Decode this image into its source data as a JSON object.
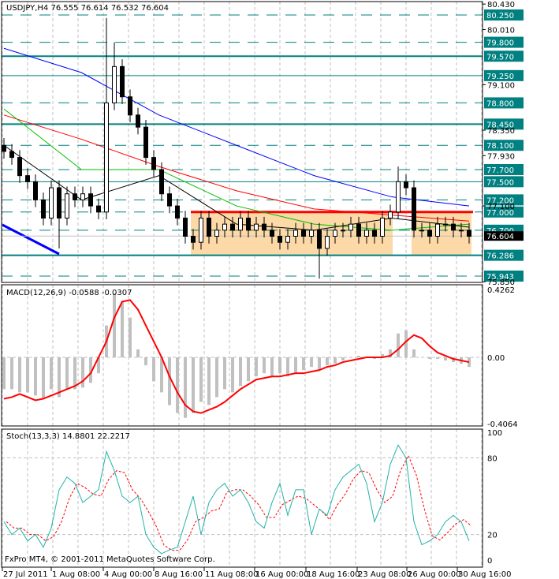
{
  "colors": {
    "level": "#008080",
    "label_bg": "#008080",
    "ma_blue": "#0000ff",
    "ma_red": "#ff0000",
    "ma_green": "#00c000",
    "ma_black": "#000000",
    "zone": "#fcd9a6",
    "macd_hist": "#c0c0c0",
    "macd_signal": "#ff0000",
    "stoch_main": "#20b2aa",
    "stoch_signal": "#ff0000"
  },
  "chart_data": [
    {
      "type": "candlestick",
      "title": "USDJPY,H4",
      "quote": {
        "open": "76.555",
        "high": "76.614",
        "low": "76.532",
        "close": "76.604"
      },
      "current_price": "76.604",
      "ylim": [
        75.85,
        80.43
      ],
      "plain_ticks": [
        "80.430",
        "80.010",
        "79.100",
        "78.350",
        "77.930",
        "77.100",
        "75.850"
      ],
      "levels": [
        {
          "price": 80.25,
          "label": "80.250",
          "style": "dashed"
        },
        {
          "price": 79.8,
          "label": "79.800",
          "style": "dashed"
        },
        {
          "price": 79.57,
          "label": "79.570",
          "style": "thick"
        },
        {
          "price": 79.25,
          "label": "79.250",
          "style": "solid"
        },
        {
          "price": 78.8,
          "label": "78.800",
          "style": "dashed"
        },
        {
          "price": 78.45,
          "label": "78.450",
          "style": "thick"
        },
        {
          "price": 78.1,
          "label": "78.100",
          "style": "dashed"
        },
        {
          "price": 77.7,
          "label": "77.700",
          "style": "dashed"
        },
        {
          "price": 77.5,
          "label": "77.500",
          "style": "solid"
        },
        {
          "price": 77.2,
          "label": "77.200",
          "style": "dashed"
        },
        {
          "price": 77.0,
          "label": "77.000",
          "style": "dashed"
        },
        {
          "price": 76.7,
          "label": "76.700",
          "style": "dashed"
        },
        {
          "price": 76.286,
          "label": "76.286",
          "style": "thick"
        },
        {
          "price": 75.943,
          "label": "75.943",
          "style": "dashed"
        }
      ],
      "closes": [
        78.0,
        77.9,
        77.6,
        77.5,
        77.2,
        76.9,
        77.4,
        76.9,
        77.3,
        77.2,
        77.3,
        77.1,
        77.0,
        78.8,
        79.4,
        78.9,
        78.6,
        78.4,
        77.9,
        77.7,
        77.3,
        77.1,
        76.9,
        76.6,
        76.5,
        76.9,
        76.6,
        76.7,
        76.8,
        76.7,
        76.9,
        76.7,
        76.8,
        76.7,
        76.6,
        76.5,
        76.6,
        76.7,
        76.6,
        76.7,
        76.4,
        76.6,
        76.7,
        76.7,
        76.8,
        76.6,
        76.7,
        76.6,
        76.9,
        77.0,
        77.5,
        77.4,
        76.7,
        76.7,
        76.6,
        76.8,
        76.8,
        76.7,
        76.7,
        76.6
      ],
      "spikes": [
        {
          "i": 13,
          "high": 80.2
        },
        {
          "i": 14,
          "high": 79.8
        },
        {
          "i": 40,
          "low": 75.9
        },
        {
          "i": 50,
          "high": 77.75
        },
        {
          "i": 7,
          "low": 76.4
        }
      ],
      "moving_averages": [
        {
          "name": "blue",
          "values": [
            79.7,
            79.3,
            78.6,
            78.1,
            77.6,
            77.25,
            77.1
          ]
        },
        {
          "name": "red",
          "values": [
            78.6,
            78.2,
            77.75,
            77.35,
            77.05,
            76.95,
            76.85
          ]
        },
        {
          "name": "green",
          "values": [
            78.7,
            77.7,
            77.7,
            77.1,
            76.8,
            76.7,
            76.8
          ]
        },
        {
          "name": "black",
          "values": [
            78.1,
            77.2,
            77.6,
            76.8,
            76.7,
            76.9,
            76.75
          ]
        }
      ],
      "zones": [
        {
          "from": [
            24,
            49
          ],
          "top": 77.0,
          "bottom": 76.286
        },
        {
          "from": [
            52,
            59
          ],
          "top": 77.0,
          "bottom": 76.286
        }
      ],
      "trendline": {
        "from": [
          78.0,
          76.286
        ]
      }
    },
    {
      "type": "macd",
      "label": "MACD(12,26,9) -0.0588 -0.0307",
      "ylim": [
        -0.4064,
        0.4262
      ],
      "ticks": [
        "0.4262",
        "0.00",
        "-0.4064"
      ],
      "histogram": [
        -0.2,
        -0.2,
        -0.22,
        -0.22,
        -0.24,
        -0.26,
        -0.2,
        -0.25,
        -0.2,
        -0.2,
        -0.19,
        -0.16,
        -0.1,
        0.2,
        0.4,
        0.35,
        0.25,
        0.05,
        -0.05,
        -0.15,
        -0.22,
        -0.3,
        -0.35,
        -0.38,
        -0.35,
        -0.28,
        -0.3,
        -0.25,
        -0.2,
        -0.22,
        -0.18,
        -0.15,
        -0.12,
        -0.1,
        -0.12,
        -0.1,
        -0.12,
        -0.1,
        -0.08,
        -0.06,
        -0.08,
        -0.05,
        -0.04,
        -0.02,
        0.0,
        0.01,
        0.0,
        -0.01,
        0.02,
        0.05,
        0.15,
        0.17,
        0.05,
        0.0,
        -0.01,
        -0.01,
        -0.02,
        -0.03,
        -0.04,
        -0.06
      ],
      "signal": [
        -0.26,
        -0.25,
        -0.23,
        -0.25,
        -0.27,
        -0.26,
        -0.24,
        -0.22,
        -0.2,
        -0.18,
        -0.15,
        -0.1,
        0.0,
        0.1,
        0.25,
        0.35,
        0.36,
        0.3,
        0.2,
        0.1,
        -0.0,
        -0.12,
        -0.22,
        -0.3,
        -0.34,
        -0.35,
        -0.33,
        -0.31,
        -0.28,
        -0.24,
        -0.2,
        -0.17,
        -0.14,
        -0.13,
        -0.12,
        -0.12,
        -0.11,
        -0.1,
        -0.1,
        -0.09,
        -0.08,
        -0.06,
        -0.05,
        -0.03,
        -0.02,
        -0.01,
        0.0,
        0.0,
        0.0,
        0.01,
        0.05,
        0.1,
        0.14,
        0.12,
        0.07,
        0.03,
        0.01,
        -0.01,
        -0.02,
        -0.03
      ]
    },
    {
      "type": "stochastic",
      "label": "Stoch(13,3,3) 14.8801 22.2217",
      "ylim": [
        0,
        100
      ],
      "ticks": [
        "100",
        "80",
        "20",
        "0"
      ],
      "main": [
        30,
        20,
        25,
        15,
        20,
        10,
        25,
        55,
        65,
        60,
        45,
        50,
        55,
        85,
        70,
        50,
        45,
        50,
        20,
        10,
        5,
        8,
        10,
        30,
        50,
        20,
        45,
        55,
        60,
        50,
        55,
        45,
        30,
        25,
        45,
        60,
        35,
        55,
        55,
        20,
        40,
        35,
        55,
        65,
        70,
        75,
        60,
        30,
        45,
        75,
        90,
        80,
        30,
        12,
        15,
        20,
        30,
        35,
        30,
        15
      ]
    }
  ],
  "time_axis": [
    "27 Jul 2011",
    "1 Aug 08:00",
    "4 Aug 00:00",
    "8 Aug 16:00",
    "11 Aug 08:00",
    "16 Aug 00:00",
    "18 Aug 16:00",
    "23 Aug 08:00",
    "26 Aug 00:00",
    "30 Aug 16:00"
  ],
  "copyright": "FxPro MT4, © 2001-2011 MetaQuotes Software Corp."
}
